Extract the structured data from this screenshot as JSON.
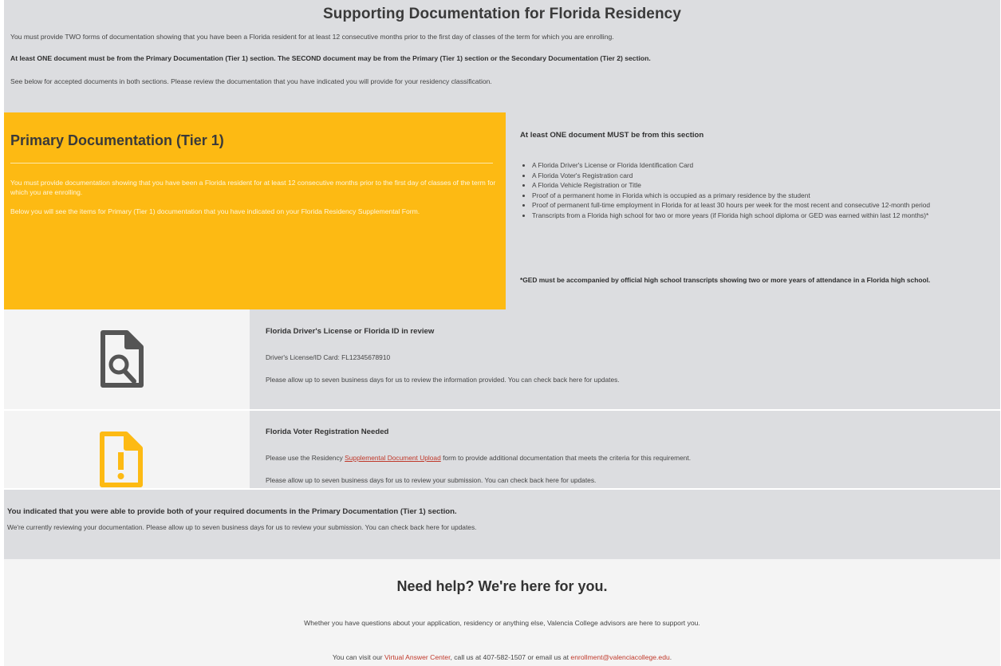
{
  "intro": {
    "title": "Supporting Documentation for Florida Residency",
    "p1": "You must provide TWO forms of documentation showing that you have been a Florida resident for at least 12 consecutive months prior to the first day of classes of the term for which you are enrolling.",
    "p2": "At least ONE document must be from the Primary Documentation (Tier 1) section. The SECOND document may be from the Primary (Tier 1) section or the Secondary Documentation (Tier 2) section.",
    "p3": "See below for accepted documents in both sections. Please review the documentation that you have indicated you will provide for your residency classification."
  },
  "primary": {
    "heading": "Primary Documentation (Tier 1)",
    "desc1": "You must provide documentation showing that you have been a Florida resident for at least 12 consecutive months prior to the first day of classes of the term for which you are enrolling.",
    "desc2": "Below you will see the items for Primary (Tier 1) documentation that you have indicated on your Florida Residency Supplemental Form.",
    "must_heading": "At least ONE document MUST be from this section",
    "items": [
      "A Florida Driver's License or Florida Identification Card",
      "A Florida Voter's Registration card",
      "A Florida Vehicle Registration or Title",
      "Proof of a permanent home in Florida which is occupied as a primary residence by the student",
      "Proof of permanent full-time employment in Florida for at least 30 hours per week for the most recent and consecutive 12-month period",
      "Transcripts from a Florida high school for two or more years (if Florida high school diploma or GED was earned within last 12 months)*"
    ],
    "ged_note": "*GED must be accompanied by official high school transcripts showing two or more years of attendance in a Florida high school."
  },
  "docs": [
    {
      "title": "Florida Driver's License or Florida ID in review",
      "detail": "Driver's License/ID Card: FL12345678910",
      "note": "Please allow up to seven business days for us to review the information provided. You can check back here for updates.",
      "icon": "document-search-icon",
      "icon_color": "#555555"
    },
    {
      "title": "Florida Voter Registration Needed",
      "detail_before": "Please use the Residency ",
      "detail_link": "Supplemental Document Upload",
      "detail_after": " form to provide additional documentation that meets the criteria for this requirement.",
      "note": "Please allow up to seven business days for us to review your submission. You can check back here for updates.",
      "icon": "document-alert-icon",
      "icon_color": "#fdba13"
    }
  ],
  "summary": {
    "headline": "You indicated that you were able to provide both of your required documents in the Primary Documentation (Tier 1) section.",
    "text": "We're currently reviewing your documentation. Please allow up to seven business days for us to review your submission. You can check back here for updates."
  },
  "help": {
    "heading": "Need help? We're here for you.",
    "text": "Whether you have questions about your application, residency or anything else, Valencia College advisors are here to support you.",
    "contact_before": "You can visit our ",
    "vac_link": "Virtual Answer Center",
    "contact_mid": ", call us at 407-582-1507 or email us at ",
    "email_link": "enrollment@valenciacollege.edu",
    "contact_end": "."
  },
  "colors": {
    "accent": "#fdba13",
    "panel": "#dcdde0",
    "link": "#c0392b"
  }
}
